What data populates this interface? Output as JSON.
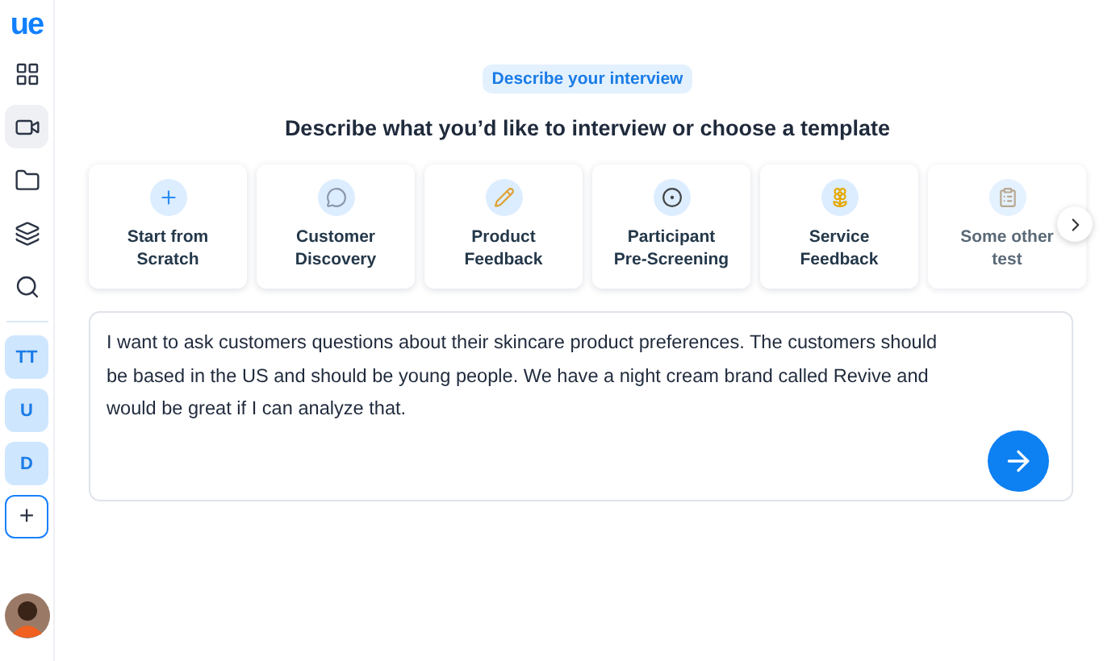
{
  "sidebar": {
    "logo": "ue",
    "nav": [
      {
        "selected": false
      },
      {
        "selected": true
      },
      {
        "selected": false
      },
      {
        "selected": false
      },
      {
        "selected": false
      }
    ],
    "workspaces": [
      "TT",
      "U",
      "D"
    ],
    "add_label": "+"
  },
  "badge": "Describe your interview",
  "heading": "Describe what you’d like to interview or choose a template",
  "templates": [
    {
      "label": "Start from Scratch"
    },
    {
      "label": "Customer Discovery"
    },
    {
      "label": "Product Feedback"
    },
    {
      "label": "Participant Pre-Screening"
    },
    {
      "label": "Service Feedback"
    },
    {
      "label": "Some other test"
    }
  ],
  "prompt": {
    "value": "I want to ask customers questions about their skincare product preferences. The customers should be based in the US and should be young people. We have a night cream brand called Revive and would be great if I can analyze that."
  }
}
